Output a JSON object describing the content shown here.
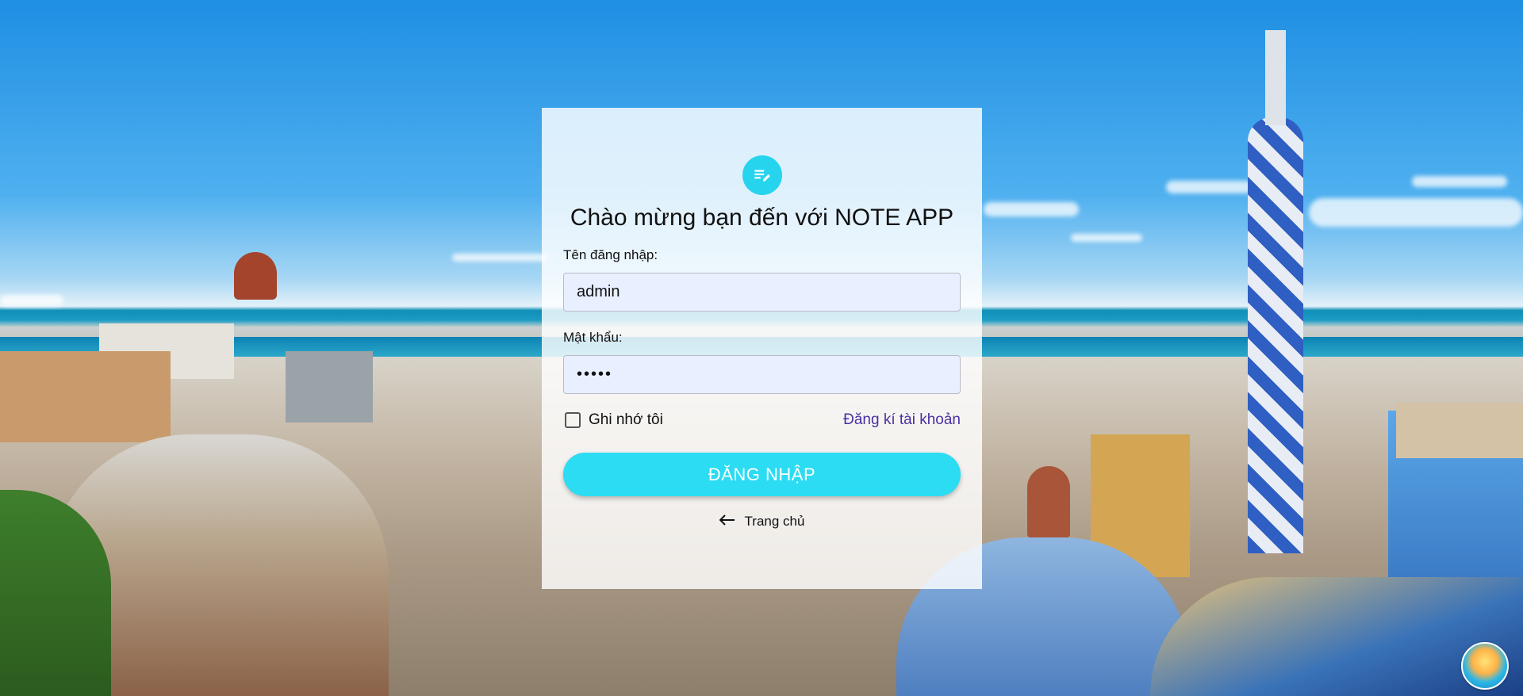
{
  "login": {
    "title": "Chào mừng bạn đến với NOTE APP",
    "username_label": "Tên đăng nhập:",
    "username_value": "admin",
    "password_label": "Mật khẩu:",
    "password_value": "•••••",
    "remember_label": "Ghi nhớ tôi",
    "register_link": "Đăng kí tài khoản",
    "submit_label": "ĐĂNG NHẬP",
    "home_label": "Trang chủ"
  },
  "icons": {
    "logo": "note-edit-icon",
    "back": "arrow-left-icon",
    "badge": "island-badge-icon"
  },
  "colors": {
    "accent": "#2bdcf3",
    "link": "#4a2fa3",
    "input_bg": "#e8efff"
  }
}
